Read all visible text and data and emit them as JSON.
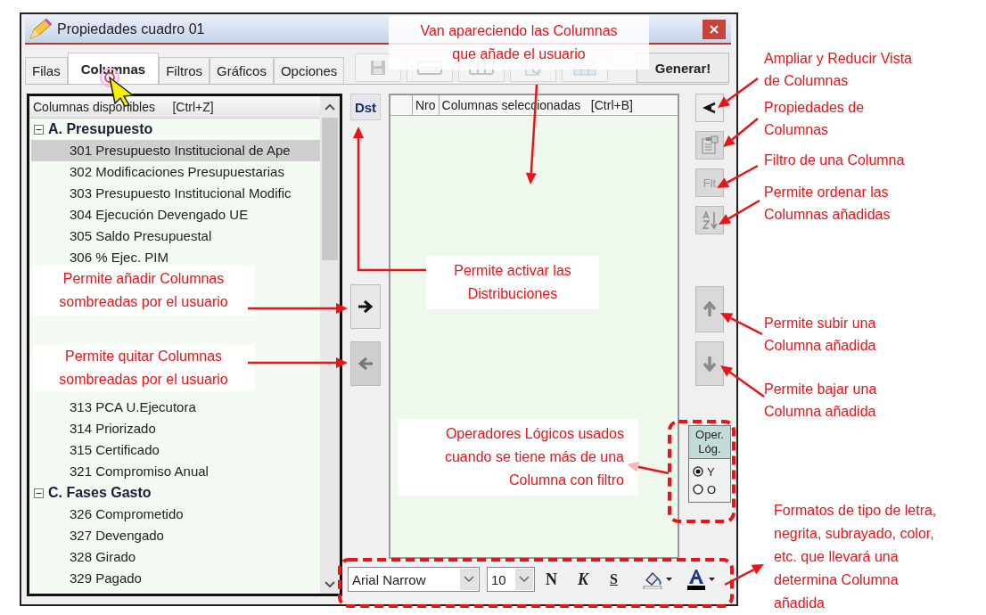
{
  "window": {
    "title": "Propiedades cuadro 01"
  },
  "tabs": [
    {
      "label": "Filas",
      "selected": false
    },
    {
      "label": "Columnas",
      "selected": true
    },
    {
      "label": "Filtros",
      "selected": false
    },
    {
      "label": "Gráficos",
      "selected": false
    },
    {
      "label": "Opciones",
      "selected": false
    }
  ],
  "tool_buttons": [
    {
      "kind": "save",
      "disabled": true
    },
    {
      "kind": "layout_rows",
      "disabled": true
    },
    {
      "kind": "layout_cols",
      "disabled": true
    },
    {
      "kind": "preview",
      "disabled": true
    },
    {
      "kind": "grid",
      "disabled": true
    }
  ],
  "generate_button": "Generar!",
  "available": {
    "header": "Columnas disponibles     [Ctrl+Z]",
    "groups": [
      {
        "label": "A. Presupuesto",
        "expanded": true,
        "children": [
          {
            "label": "301 Presupuesto Institucional de Ape",
            "selected": true
          },
          {
            "label": "302 Modificaciones Presupuestarias",
            "selected": false
          },
          {
            "label": "303 Presupuesto Institucional Modific",
            "selected": false
          },
          {
            "label": "304 Ejecución Devengado UE",
            "selected": false
          },
          {
            "label": "305 Saldo Presupuestal",
            "selected": false
          },
          {
            "label": "306 % Ejec. PIM",
            "selected": false
          }
        ]
      },
      {
        "children": [
          {
            "label": "313 PCA U.Ejecutora",
            "selected": false
          },
          {
            "label": "314 Priorizado",
            "selected": false
          },
          {
            "label": "315 Certificado",
            "selected": false
          },
          {
            "label": "321 Compromiso Anual",
            "selected": false
          }
        ]
      },
      {
        "label": "C. Fases Gasto",
        "expanded": true,
        "children": [
          {
            "label": "326 Comprometido",
            "selected": false
          },
          {
            "label": "327 Devengado",
            "selected": false
          },
          {
            "label": "328 Girado",
            "selected": false
          },
          {
            "label": "329 Pagado",
            "selected": false
          }
        ]
      }
    ]
  },
  "dst_button": "Dst",
  "move_buttons": [
    {
      "kind": "add",
      "disabled": false
    },
    {
      "kind": "remove",
      "disabled": true
    }
  ],
  "selected_list": {
    "columns": [
      "Nro",
      "Columnas seleccionadas   [Ctrl+B]"
    ]
  },
  "side_buttons": [
    {
      "kind": "collapse",
      "disabled": false
    },
    {
      "kind": "properties",
      "disabled": true
    },
    {
      "kind": "filter",
      "label": "Flt",
      "disabled": true
    },
    {
      "kind": "sort",
      "disabled": true
    },
    {
      "kind": "up",
      "disabled": true
    },
    {
      "kind": "down",
      "disabled": true
    }
  ],
  "logic_operators": {
    "title": [
      "Oper.",
      "Lóg."
    ],
    "options": [
      {
        "label": "Y",
        "selected": true
      },
      {
        "label": "O",
        "selected": false
      }
    ]
  },
  "format_bar": {
    "font": "Arial Narrow",
    "size": "10",
    "buttons": [
      {
        "kind": "bold",
        "label": "N"
      },
      {
        "kind": "italic",
        "label": "K"
      },
      {
        "kind": "underline",
        "label": "S"
      },
      {
        "kind": "fill_color"
      },
      {
        "kind": "font_color"
      }
    ]
  },
  "annotations": [
    {
      "lines": [
        "Van apareciendo las Columnas",
        "que añade el usuario"
      ]
    },
    {
      "lines": [
        "Ampliar y Reducir Vista",
        "de Columnas"
      ]
    },
    {
      "lines": [
        "Propiedades de",
        "Columnas"
      ]
    },
    {
      "lines": [
        "Filtro de una Columna"
      ]
    },
    {
      "lines": [
        "Permite ordenar las",
        "Columnas añadidas"
      ]
    },
    {
      "lines": [
        "Permite añadir Columnas",
        "sombreadas por el usuario"
      ]
    },
    {
      "lines": [
        "Permite activar las",
        "Distribuciones"
      ]
    },
    {
      "lines": [
        "Permite subir una",
        "Columna añadida"
      ]
    },
    {
      "lines": [
        "Permite quitar Columnas",
        "sombreadas por el usuario"
      ]
    },
    {
      "lines": [
        "Permite bajar una",
        "Columna añadida"
      ]
    },
    {
      "lines": [
        "Operadores Lógicos usados",
        "cuando se tiene más de una",
        "Columna con filtro"
      ]
    },
    {
      "lines": [
        "Formatos de tipo de letra,",
        "negrita, subrayado, color,",
        "etc. que llevará una",
        "determina Columna",
        "añadida"
      ]
    }
  ]
}
